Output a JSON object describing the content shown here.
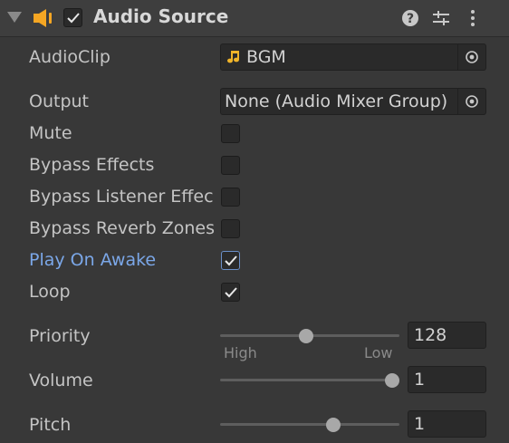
{
  "component": {
    "title": "Audio Source",
    "enabled": true,
    "icons": [
      "foldout-arrow-icon",
      "speaker-icon",
      "help-icon",
      "presets-icon",
      "more-menu-icon"
    ]
  },
  "fields": {
    "audioclip": {
      "label": "AudioClip",
      "value": "BGM",
      "icon": "music-note-icon"
    },
    "output": {
      "label": "Output",
      "value": "None (Audio Mixer Group)"
    },
    "mute": {
      "label": "Mute",
      "checked": false
    },
    "bypass_effects": {
      "label": "Bypass Effects",
      "checked": false
    },
    "bypass_listener": {
      "label": "Bypass Listener Effec",
      "checked": false
    },
    "bypass_reverb": {
      "label": "Bypass Reverb Zones",
      "checked": false
    },
    "play_on_awake": {
      "label": "Play On Awake",
      "checked": true
    },
    "loop": {
      "label": "Loop",
      "checked": true
    },
    "priority": {
      "label": "Priority",
      "value": "128",
      "fraction": 0.5,
      "hint_low": "High",
      "hint_high": "Low"
    },
    "volume": {
      "label": "Volume",
      "value": "1",
      "fraction": 1.0
    },
    "pitch": {
      "label": "Pitch",
      "value": "1",
      "fraction": 0.66
    }
  },
  "colors": {
    "background": "#383838",
    "header": "#3e3e3e",
    "field": "#2a2a2a",
    "active_label": "#7ba7e8",
    "speaker": "#f5a623"
  }
}
